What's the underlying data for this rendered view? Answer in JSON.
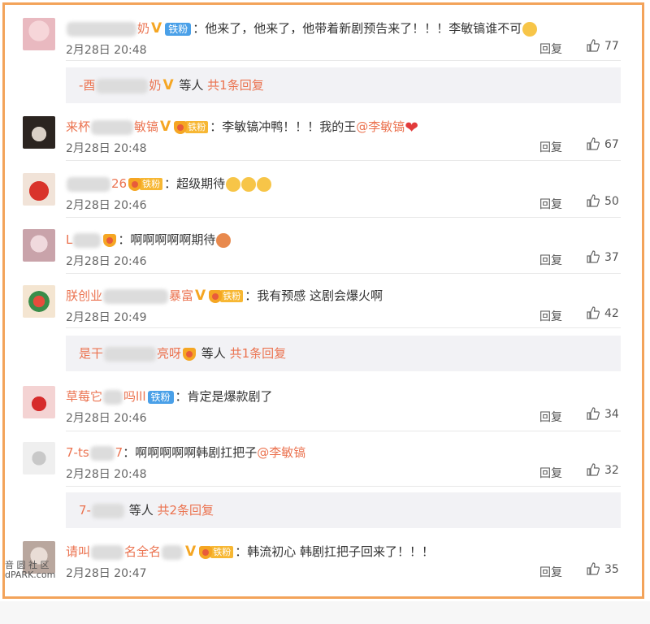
{
  "comments": [
    {
      "name_prefix": "",
      "name_suffix": "奶",
      "vbadge": "V",
      "fan_badge": "铁粉",
      "level_tag": "",
      "text": "：他来了，他来了，他带着新剧预告来了！！！李敏镐谁不可",
      "mention": "",
      "time": "2月28日 20:48",
      "reply": "回复",
      "likes": "77",
      "emoji": "cry"
    },
    {
      "name_prefix": "来杯",
      "name_suffix": "敏镐",
      "vbadge": "V",
      "fan_badge": "",
      "level_tag": "铁粉",
      "text": "：李敏镐冲鸭！！！我的王",
      "mention": "@李敏镐",
      "time": "2月28日 20:48",
      "reply": "回复",
      "likes": "67",
      "emoji": "heart"
    },
    {
      "name_prefix": "",
      "name_suffix": "26",
      "vbadge": "",
      "fan_badge": "",
      "level_tag": "铁粉",
      "text": "：超级期待",
      "mention": "",
      "time": "2月28日 20:46",
      "reply": "回复",
      "likes": "50",
      "emoji": "scream3"
    },
    {
      "name_prefix": "L",
      "name_suffix": "",
      "vbadge": "",
      "fan_badge": "",
      "level_tag": "",
      "text": "：啊啊啊啊啊期待",
      "mention": "",
      "time": "2月28日 20:46",
      "reply": "回复",
      "likes": "37",
      "emoji": "face"
    },
    {
      "name_prefix": "朕创业",
      "name_suffix": "暴富",
      "vbadge": "V",
      "fan_badge": "",
      "level_tag": "铁粉",
      "text": "：我有预感 这剧会爆火啊",
      "mention": "",
      "time": "2月28日 20:49",
      "reply": "回复",
      "likes": "42",
      "emoji": ""
    },
    {
      "name_prefix": "草莓它",
      "name_suffix": "吗lll",
      "vbadge": "",
      "fan_badge": "铁粉",
      "level_tag": "",
      "text": "：肯定是爆款剧了",
      "mention": "",
      "time": "2月28日 20:46",
      "reply": "回复",
      "likes": "34",
      "emoji": ""
    },
    {
      "name_prefix": "7-ts",
      "name_suffix": "7",
      "vbadge": "",
      "fan_badge": "",
      "level_tag": "",
      "text": "：啊啊啊啊啊韩剧扛把子",
      "mention": "@李敏镐",
      "time": "2月28日 20:48",
      "reply": "回复",
      "likes": "32",
      "emoji": ""
    },
    {
      "name_prefix": "请叫",
      "name_suffix": "名全名",
      "vbadge": "V",
      "fan_badge": "",
      "level_tag": "铁粉",
      "text": "：韩流初心 韩剧扛把子回来了！！！",
      "mention": "",
      "time": "2月28日 20:47",
      "reply": "回复",
      "likes": "35",
      "emoji": ""
    }
  ],
  "subreplies": [
    {
      "name_prefix": "-酉",
      "name_suffix": "奶",
      "badge": "V",
      "suffix_text": " 等人 ",
      "count_text": "共1条回复"
    },
    {
      "name_prefix": "是干",
      "name_suffix": "亮呀",
      "badge": "lvl",
      "suffix_text": " 等人 ",
      "count_text": "共1条回复"
    },
    {
      "name_prefix": "7-",
      "name_suffix": "",
      "badge": "",
      "suffix_text": " 等人 ",
      "count_text": "共2条回复"
    }
  ],
  "watermark": {
    "line1": "音 圆 社 区",
    "line2": "dPARK.com"
  },
  "colors": {
    "accent": "#eb7350",
    "border": "#f3a35a",
    "fan_badge": "#4aa0e8"
  }
}
